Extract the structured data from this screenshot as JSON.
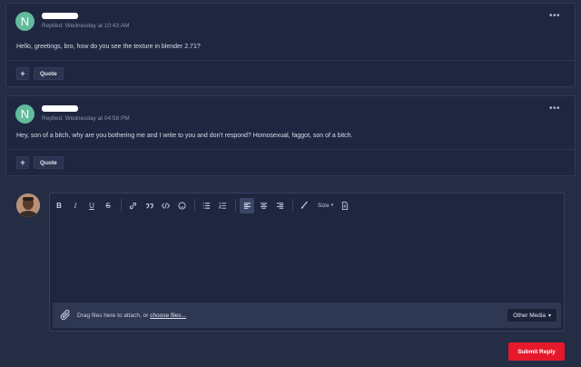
{
  "colors": {
    "background": "#252d45",
    "panel": "#1f2740",
    "accent_avatar": "#62bb9c",
    "submit": "#e5192b"
  },
  "posts": [
    {
      "avatar_letter": "N",
      "date": "Replied: Wednesday at 10:43 AM",
      "menu": "•••",
      "text": "Hello, greetings, bro, how do you see the texture in blender 2.71?",
      "actions": {
        "plus": "+",
        "quote": "Quote"
      }
    },
    {
      "avatar_letter": "N",
      "date": "Replied: Wednesday at 04:58 PM",
      "menu": "•••",
      "text": "Hey, son of a bitch, why are you bothering me and I write to you and don't respond? Homosexual, faggot, son of a bitch.",
      "actions": {
        "plus": "+",
        "quote": "Quote"
      }
    }
  ],
  "editor": {
    "toolbar": {
      "bold": "B",
      "italic": "I",
      "underline": "U",
      "strike": "S",
      "size_label": "Size"
    },
    "attach_text": "Drag files here to attach, or ",
    "attach_link": "choose files...",
    "media_button": "Other Media"
  },
  "submit_label": "Submit Reply"
}
